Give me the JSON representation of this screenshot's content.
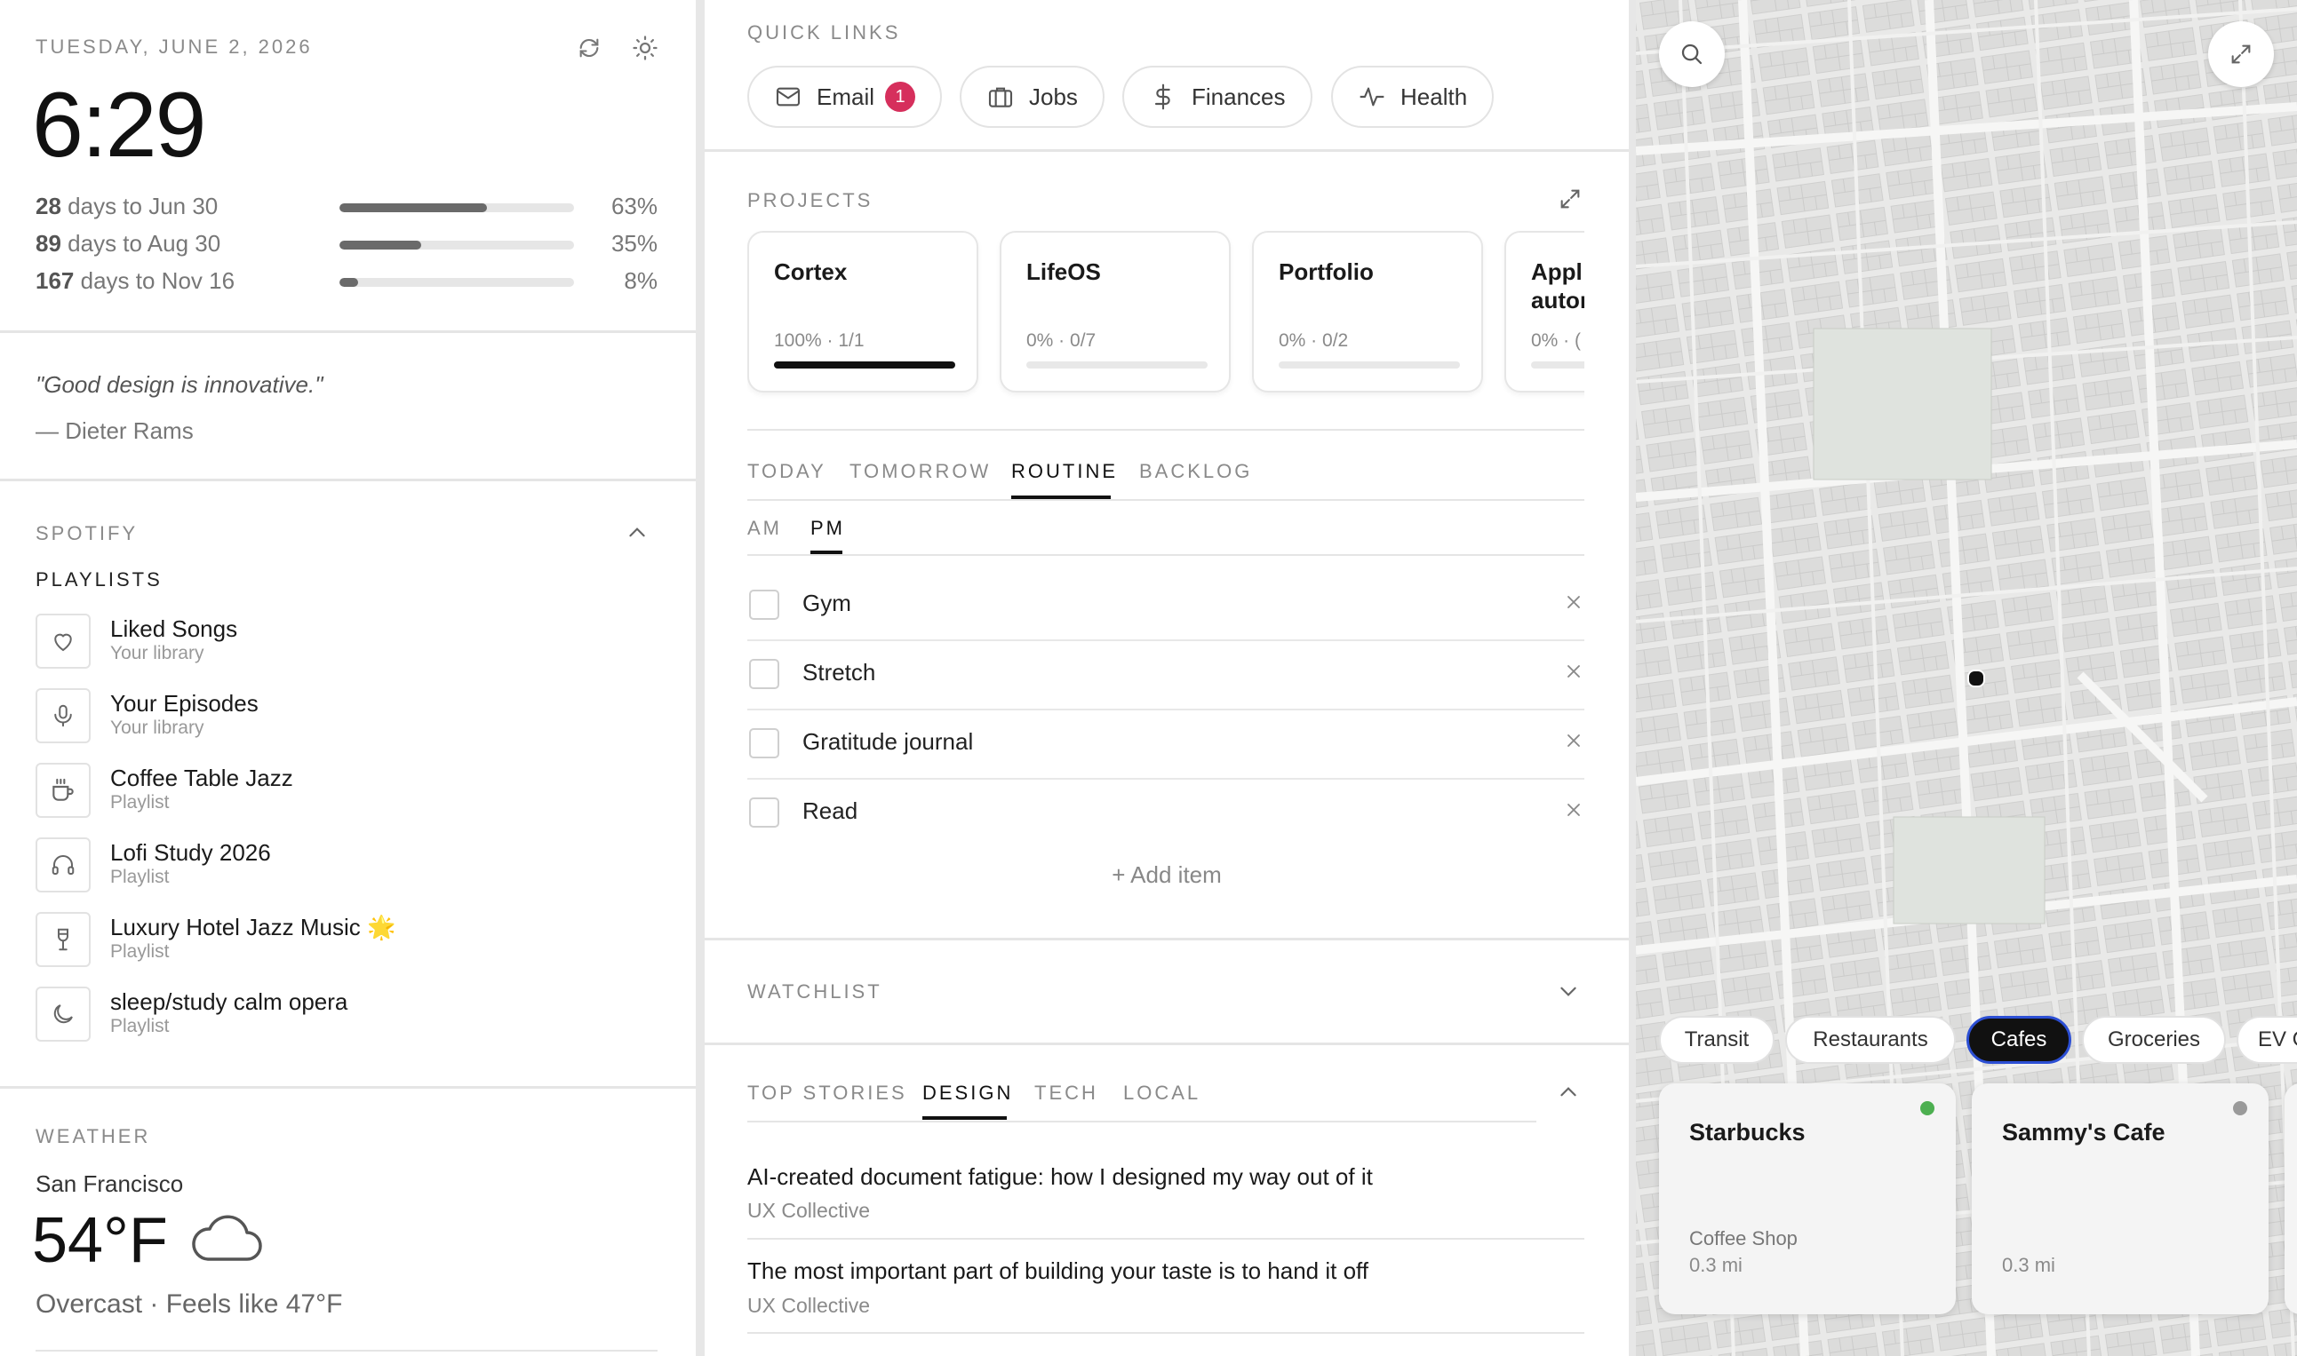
{
  "header": {
    "date": "TUESDAY, JUNE 2, 2026",
    "time": "6:29"
  },
  "countdowns": [
    {
      "days": "28",
      "label": " days to Jun 30",
      "percent_text": "63%",
      "progress": 0.63
    },
    {
      "days": "89",
      "label": " days to Aug 30",
      "percent_text": "35%",
      "progress": 0.35
    },
    {
      "days": "167",
      "label": " days to Nov 16",
      "percent_text": "8%",
      "progress": 0.08
    }
  ],
  "quote": {
    "text": "\"Good design is innovative.\"",
    "author": "— Dieter Rams"
  },
  "spotify": {
    "title": "SPOTIFY",
    "playlists_label": "PLAYLISTS",
    "items": [
      {
        "name": "Liked Songs",
        "subtitle": "Your library",
        "icon": "heart-icon"
      },
      {
        "name": "Your Episodes",
        "subtitle": "Your library",
        "icon": "microphone-icon"
      },
      {
        "name": "Coffee Table Jazz",
        "subtitle": "Playlist",
        "icon": "coffee-cup-icon"
      },
      {
        "name": "Lofi Study 2026",
        "subtitle": "Playlist",
        "icon": "headphones-icon"
      },
      {
        "name": "Luxury Hotel Jazz Music 🌟",
        "subtitle": "Playlist",
        "icon": "wine-glass-icon"
      },
      {
        "name": "sleep/study calm opera",
        "subtitle": "Playlist",
        "icon": "moon-icon"
      }
    ]
  },
  "weather": {
    "title": "WEATHER",
    "city": "San Francisco",
    "temperature": "54°F",
    "condition": "Overcast · Feels like 47°F",
    "icon": "cloud-icon"
  },
  "quick_links": {
    "title": "QUICK LINKS",
    "items": [
      {
        "label": "Email",
        "icon": "mail-icon",
        "badge": "1"
      },
      {
        "label": "Jobs",
        "icon": "briefcase-icon"
      },
      {
        "label": "Finances",
        "icon": "dollar-icon"
      },
      {
        "label": "Health",
        "icon": "pulse-icon"
      }
    ]
  },
  "projects": {
    "title": "PROJECTS",
    "items": [
      {
        "name": "Cortex",
        "status": "100% · 1/1",
        "progress": 1.0
      },
      {
        "name": "LifeOS",
        "status": "0% · 0/7",
        "progress": 0
      },
      {
        "name": "Portfolio",
        "status": "0% · 0/2",
        "progress": 0
      },
      {
        "name": "Appl autoı",
        "status": "0% · (",
        "progress": 0
      }
    ]
  },
  "tasks": {
    "tabs": [
      "TODAY",
      "TOMORROW",
      "ROUTINE",
      "BACKLOG"
    ],
    "active_tab": "ROUTINE",
    "subtabs": [
      "AM",
      "PM"
    ],
    "active_subtab": "PM",
    "items": [
      "Gym",
      "Stretch",
      "Gratitude journal",
      "Read"
    ],
    "add_label": "+ Add item"
  },
  "watchlist": {
    "title": "WATCHLIST"
  },
  "news": {
    "tabs": [
      "TOP STORIES",
      "DESIGN",
      "TECH",
      "LOCAL"
    ],
    "active_tab": "DESIGN",
    "stories": [
      {
        "title": "AI-created document fatigue: how I designed my way out of it",
        "source": "UX Collective"
      },
      {
        "title": "The most important part of building your taste is to hand it off",
        "source": "UX Collective"
      }
    ]
  },
  "map": {
    "categories": [
      "Transit",
      "Restaurants",
      "Cafes",
      "Groceries",
      "EV C"
    ],
    "active_category": "Cafes",
    "places": [
      {
        "name": "Starbucks",
        "type": "Coffee Shop",
        "distance": "0.3 mi",
        "status_color": "#4caf50"
      },
      {
        "name": "Sammy's Cafe",
        "type": "",
        "distance": "0.3 mi",
        "status_color": "#9a9a9a"
      }
    ]
  }
}
